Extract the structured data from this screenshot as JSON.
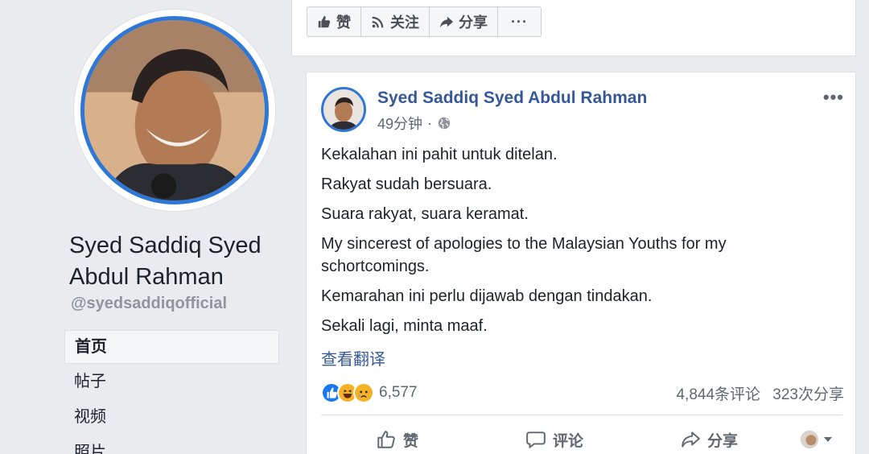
{
  "sidebar": {
    "page_name": "Syed Saddiq Syed Abdul Rahman",
    "handle": "@syedsaddiqofficial",
    "nav": [
      "首页",
      "帖子",
      "视频",
      "照片"
    ]
  },
  "topbar": {
    "like_label": "赞",
    "follow_label": "关注",
    "share_label": "分享",
    "more_label": "···"
  },
  "post": {
    "author": "Syed Saddiq Syed Abdul Rahman",
    "time": "49分钟",
    "separator": "·",
    "more": "•••",
    "paragraphs": [
      "Kekalahan ini pahit untuk ditelan.",
      "Rakyat sudah bersuara.",
      "Suara rakyat, suara keramat.",
      "My sincerest of apologies to the Malaysian Youths for my schortcomings.",
      "Kemarahan ini perlu dijawab dengan tindakan.",
      "Sekali lagi, minta maaf."
    ],
    "translate_link": "查看翻译",
    "reaction_count": "6,577",
    "comments": "4,844条评论",
    "shares": "323次分享",
    "actions": {
      "like": "赞",
      "comment": "评论",
      "share": "分享"
    }
  },
  "colors": {
    "brand_blue": "#365899",
    "ring_blue": "#2d77d9",
    "background": "#e9ebee"
  }
}
